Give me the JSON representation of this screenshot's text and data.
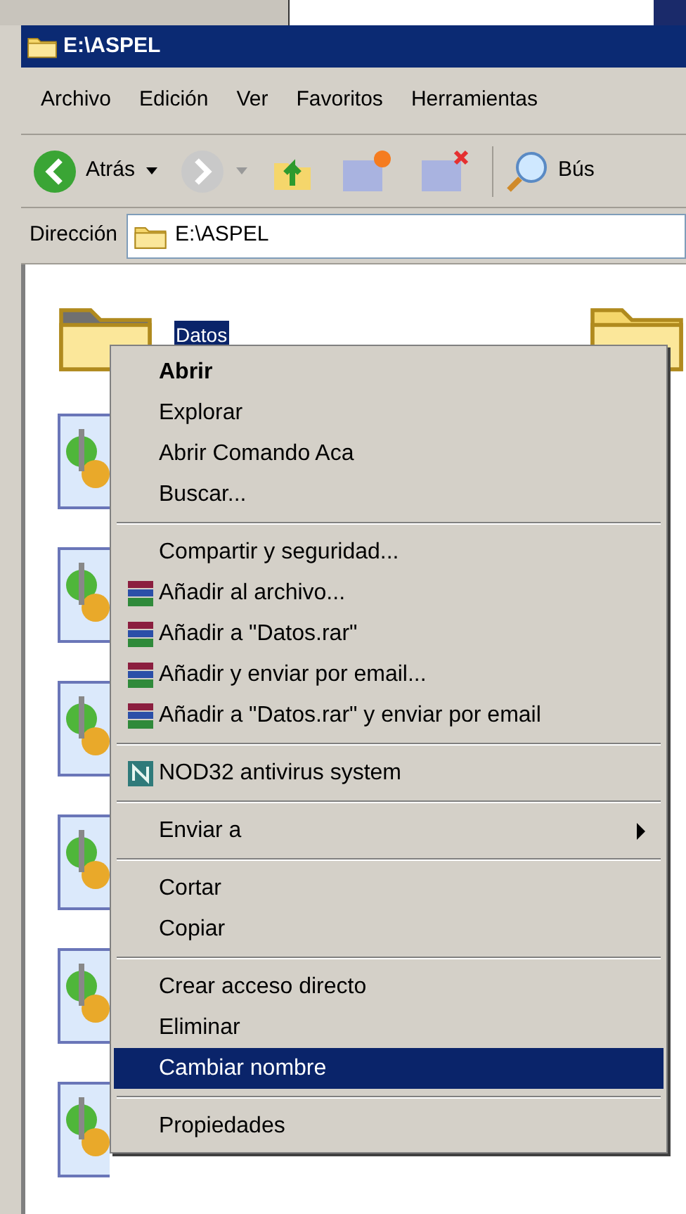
{
  "window": {
    "title": "E:\\ASPEL"
  },
  "menu_bar": [
    "Archivo",
    "Edición",
    "Ver",
    "Favoritos",
    "Herramientas"
  ],
  "toolbar": {
    "back": "Atrás",
    "search": "Bús"
  },
  "address_bar": {
    "label": "Dirección",
    "value": "E:\\ASPEL"
  },
  "files": [
    {
      "name": "Datos",
      "selected": true
    }
  ],
  "context_menu": {
    "groups": [
      [
        {
          "label": "Abrir",
          "kind": "plain",
          "default": true,
          "selected": false
        },
        {
          "label": "Explorar",
          "kind": "plain",
          "default": false,
          "selected": false
        },
        {
          "label": "Abrir Comando Aca",
          "kind": "plain",
          "default": false,
          "selected": false
        },
        {
          "label": "Buscar...",
          "kind": "plain",
          "default": false,
          "selected": false
        }
      ],
      [
        {
          "label": "Compartir y seguridad...",
          "kind": "plain",
          "default": false,
          "selected": false
        },
        {
          "label": "Añadir al archivo...",
          "kind": "rar",
          "default": false,
          "selected": false
        },
        {
          "label": "Añadir a \"Datos.rar\"",
          "kind": "rar",
          "default": false,
          "selected": false
        },
        {
          "label": "Añadir y enviar por email...",
          "kind": "rar",
          "default": false,
          "selected": false
        },
        {
          "label": "Añadir a \"Datos.rar\" y enviar por email",
          "kind": "rar",
          "default": false,
          "selected": false
        }
      ],
      [
        {
          "label": "NOD32 antivirus system",
          "kind": "antivirus",
          "default": false,
          "selected": false
        }
      ],
      [
        {
          "label": "Enviar a",
          "kind": "submenu",
          "default": false,
          "selected": false
        }
      ],
      [
        {
          "label": "Cortar",
          "kind": "plain",
          "default": false,
          "selected": false
        },
        {
          "label": "Copiar",
          "kind": "plain",
          "default": false,
          "selected": false
        }
      ],
      [
        {
          "label": "Crear acceso directo",
          "kind": "plain",
          "default": false,
          "selected": false
        },
        {
          "label": "Eliminar",
          "kind": "plain",
          "default": false,
          "selected": false
        },
        {
          "label": "Cambiar nombre",
          "kind": "plain",
          "default": false,
          "selected": true
        }
      ],
      [
        {
          "label": "Propiedades",
          "kind": "plain",
          "default": false,
          "selected": false
        }
      ]
    ]
  }
}
